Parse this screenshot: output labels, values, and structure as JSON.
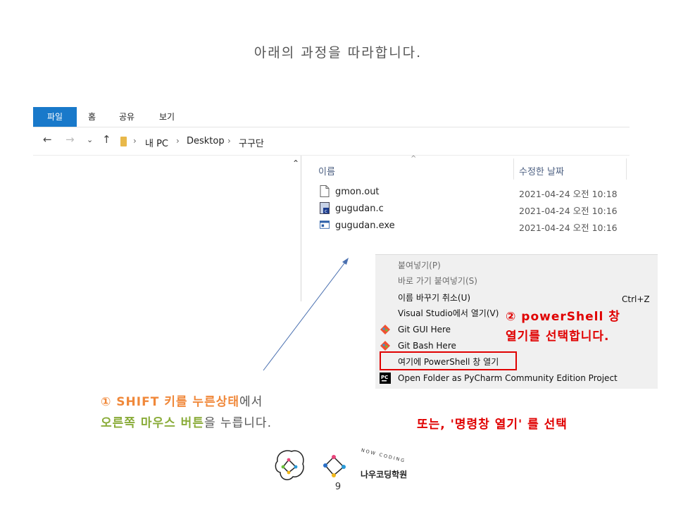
{
  "slide": {
    "title": "아래의 과정을 따라합니다.",
    "page_number": "9"
  },
  "explorer": {
    "ribbon_tabs": [
      "파일",
      "홈",
      "공유",
      "보기"
    ],
    "breadcrumb": [
      "내 PC",
      "Desktop",
      "구구단"
    ],
    "columns": {
      "name": "이름",
      "modified": "수정한 날짜"
    },
    "files": [
      {
        "name": "gmon.out",
        "date": "2021-04-24 오전 10:18",
        "icon": "blank-file-icon"
      },
      {
        "name": "gugudan.c",
        "date": "2021-04-24 오전 10:16",
        "icon": "c-source-file-icon"
      },
      {
        "name": "gugudan.exe",
        "date": "2021-04-24 오전 10:16",
        "icon": "exe-file-icon"
      }
    ]
  },
  "context_menu": {
    "items": [
      {
        "label": "붙여넣기(P)",
        "disabled": true
      },
      {
        "label": "바로 가기 붙여넣기(S)",
        "disabled": true
      },
      {
        "label": "이름 바꾸기 취소(U)",
        "shortcut": "Ctrl+Z"
      },
      {
        "label": "Visual Studio에서 열기(V)"
      },
      {
        "label": "Git GUI Here",
        "icon": "git-icon"
      },
      {
        "label": "Git Bash Here",
        "icon": "git-icon"
      },
      {
        "label": "여기에 PowerShell 창 열기"
      },
      {
        "label": "Open Folder as PyCharm Community Edition Project",
        "icon": "pycharm-icon"
      }
    ]
  },
  "annotations": {
    "step2_line1": "② powerShell 창",
    "step2_line2": "열기를 선택합니다.",
    "alternative": "또는,  '명령창 열기'  를 선택",
    "step1_line1_a": "① SHIFT 키를 누른상태",
    "step1_line1_b": "에서",
    "step1_line2_a": "오른쪽 마우스 버튼",
    "step1_line2_b": "을 누릅니다."
  },
  "logo": {
    "arc_text": "NOW CODING",
    "name": "나우코딩학원"
  },
  "colors": {
    "ribbon_active": "#1979ca",
    "highlight_red": "#e00000",
    "step1_orange": "#f0883a",
    "step1_green": "#8aac3a"
  }
}
